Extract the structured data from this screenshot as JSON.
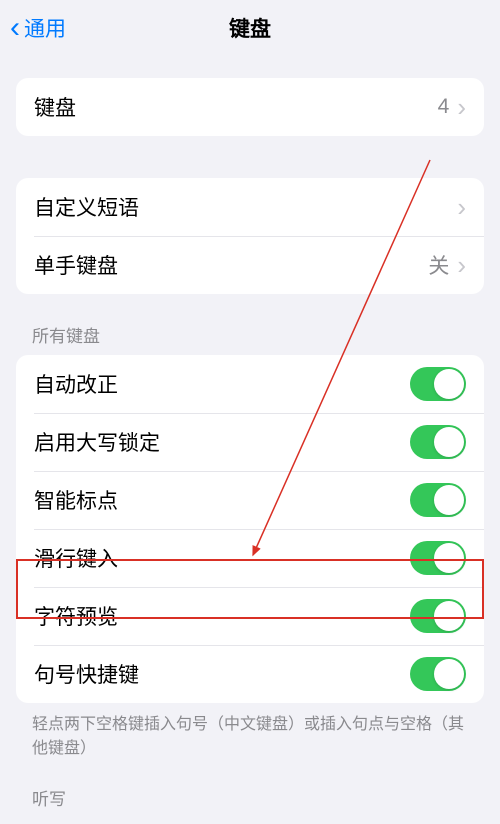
{
  "nav": {
    "back": "通用",
    "title": "键盘"
  },
  "group1": {
    "keyboards": {
      "label": "键盘",
      "value": "4"
    }
  },
  "group2": {
    "textReplacement": {
      "label": "自定义短语"
    },
    "oneHanded": {
      "label": "单手键盘",
      "value": "关"
    }
  },
  "section3": {
    "header": "所有键盘",
    "autoCorrect": {
      "label": "自动改正",
      "on": true
    },
    "capsLock": {
      "label": "启用大写锁定",
      "on": true
    },
    "smartPunct": {
      "label": "智能标点",
      "on": true
    },
    "slideType": {
      "label": "滑行键入",
      "on": true
    },
    "charPreview": {
      "label": "字符预览",
      "on": true
    },
    "periodShortcut": {
      "label": "句号快捷键",
      "on": true
    },
    "footer": "轻点两下空格键插入句号（中文键盘）或插入句点与空格（其他键盘）"
  },
  "cutoff": "听写"
}
